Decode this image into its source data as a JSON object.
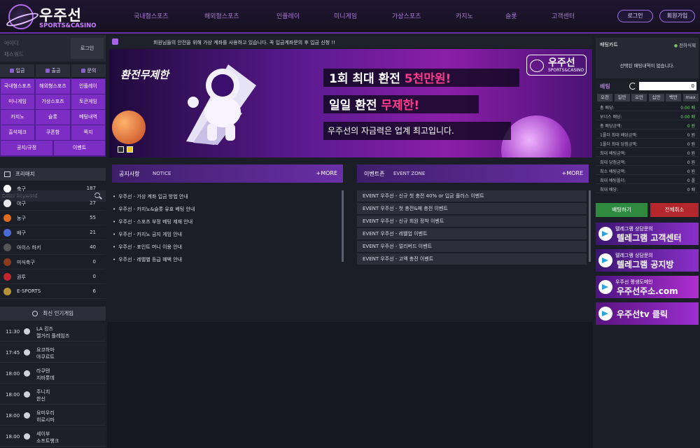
{
  "header": {
    "logo_main": "우주선",
    "logo_sub": "SPORTS&CASINO",
    "nav": [
      "국내형스포츠",
      "해외형스포츠",
      "인플레이",
      "미니게임",
      "가상스포츠",
      "카지노",
      "슬롯",
      "고객센터"
    ],
    "login": "로그인",
    "signup": "회원가입"
  },
  "login_box": {
    "id_placeholder": "아이디",
    "pw_placeholder": "패스워드",
    "btn": "로그인"
  },
  "quick": [
    "입금",
    "출금",
    "문의"
  ],
  "menu": [
    [
      "국내형스포츠",
      "해외형스포츠",
      "인플레이"
    ],
    [
      "미니게임",
      "가상스포츠",
      "토큰게임"
    ],
    [
      "카지노",
      "슬롯",
      "베팅내역"
    ],
    [
      "출석체크",
      "쿠폰함",
      "쪽지"
    ],
    [
      "공지/규정",
      "이벤트"
    ]
  ],
  "search": {
    "placeholder": "Enter keyword"
  },
  "prematch_title": "프리매치",
  "sports": [
    {
      "name": "축구",
      "count": "187",
      "color": "#ffffff"
    },
    {
      "name": "야구",
      "count": "27",
      "color": "#e8e8e8"
    },
    {
      "name": "농구",
      "count": "55",
      "color": "#e06d1d"
    },
    {
      "name": "배구",
      "count": "21",
      "color": "#4a6bd6"
    },
    {
      "name": "아이스 하키",
      "count": "40",
      "color": "#555555"
    },
    {
      "name": "미식축구",
      "count": "0",
      "color": "#8a3b1c"
    },
    {
      "name": "권투",
      "count": "0",
      "color": "#c0272d"
    },
    {
      "name": "E-SPORTS",
      "count": "6",
      "color": "#b69235"
    }
  ],
  "popular_title": "최신 인기게임",
  "games": [
    {
      "time": "11:30",
      "t1": "LA 킹즈",
      "t2": "캘거리 플레임즈"
    },
    {
      "time": "17:45",
      "t1": "요코하마",
      "t2": "야쿠르트"
    },
    {
      "time": "18:00",
      "t1": "라쿠텐",
      "t2": "지바롯데"
    },
    {
      "time": "18:00",
      "t1": "주니치",
      "t2": "한신"
    },
    {
      "time": "18:00",
      "t1": "요미우리",
      "t2": "히로시마"
    },
    {
      "time": "18:00",
      "t1": "세이부",
      "t2": "소프트뱅크"
    }
  ],
  "ticker": "회원님들의 안전을 위해 가상 계좌를 사용하고 있습니다. 꼭 입금계좌문의 후 입금 신청 !!",
  "banner": {
    "tag": "환전무제한",
    "line1a": "1회 최대 환전 ",
    "line1b": "5천만원!",
    "line2a": "일일 환전 ",
    "line2b": "무제한!",
    "line3": "우주선의 자금력은 업계 최고입니다.",
    "logo_main": "우주선",
    "logo_sub": "SPORTS&CASINO"
  },
  "notice": {
    "title": "공지사항",
    "sub": "NOTICE",
    "more": "+MORE",
    "items": [
      "우주선 - 가상 계좌 입금 방법 안내",
      "우주선 - 카지노&슬롯 유효 베팅 안내",
      "우주선 - 스포츠 부정 베팅 제재 안내",
      "우주선 - 카지노 금지 게임 안내",
      "우주선 - 포인트 머니 이용 안내",
      "우주선 - 레벨별 등급 혜택 안내"
    ]
  },
  "event": {
    "title": "이벤트존",
    "sub": "EVENT ZONE",
    "more": "+MORE",
    "items": [
      "EVENT 우주선 - 신규 첫 충전 40% or 입금 플러스 이벤트",
      "EVENT 우주선 - 첫 충전&매 충전 이벤트",
      "EVENT 우주선 - 신규 회원 정착 이벤트",
      "EVENT 우주선 - 레벨업 이벤트",
      "EVENT 우주선 - 얼리버드 이벤트",
      "EVENT 우주선 - 고액 충전 이벤트"
    ]
  },
  "betcart": {
    "title": "배팅카트",
    "sync": "전하식제",
    "empty": "선택된 배팅내역이 없습니다.",
    "label": "배팅",
    "amount": "0",
    "chips": [
      "오천",
      "일만",
      "오만",
      "십만",
      "백만",
      "max"
    ],
    "rows": [
      {
        "l": "총 배당:",
        "v": "0.00 배",
        "g": true
      },
      {
        "l": "보너스 배당:",
        "v": "0.00 배",
        "g": true
      },
      {
        "l": "총 배당금액:",
        "v": "0 원",
        "g": true
      },
      {
        "l": "1폴더 최대 배당금액:",
        "v": "0 원",
        "g": false
      },
      {
        "l": "1폴더 최대 당첨금액:",
        "v": "0 원",
        "g": false
      },
      {
        "l": "최대 배팅금액:",
        "v": "0 원",
        "g": false
      },
      {
        "l": "최대 당첨금액:",
        "v": "0 원",
        "g": false
      },
      {
        "l": "최소 배팅금액:",
        "v": "0 원",
        "g": false
      },
      {
        "l": "최대 배팅폴더:",
        "v": "0 폴",
        "g": false
      },
      {
        "l": "최대 배당:",
        "v": "0 배",
        "g": false
      }
    ],
    "bet_btn": "배팅하기",
    "clear_btn": "전체취소"
  },
  "side_banners": [
    {
      "s": "텔레그램 상담문의",
      "b": "텔레그램 고객센터"
    },
    {
      "s": "텔레그램 상담문의",
      "b": "텔레그램 공지방"
    },
    {
      "s": "우주선 평생도메인",
      "b": "우주선주소.com"
    },
    {
      "s": "",
      "b": "우주선tv 클릭"
    }
  ]
}
